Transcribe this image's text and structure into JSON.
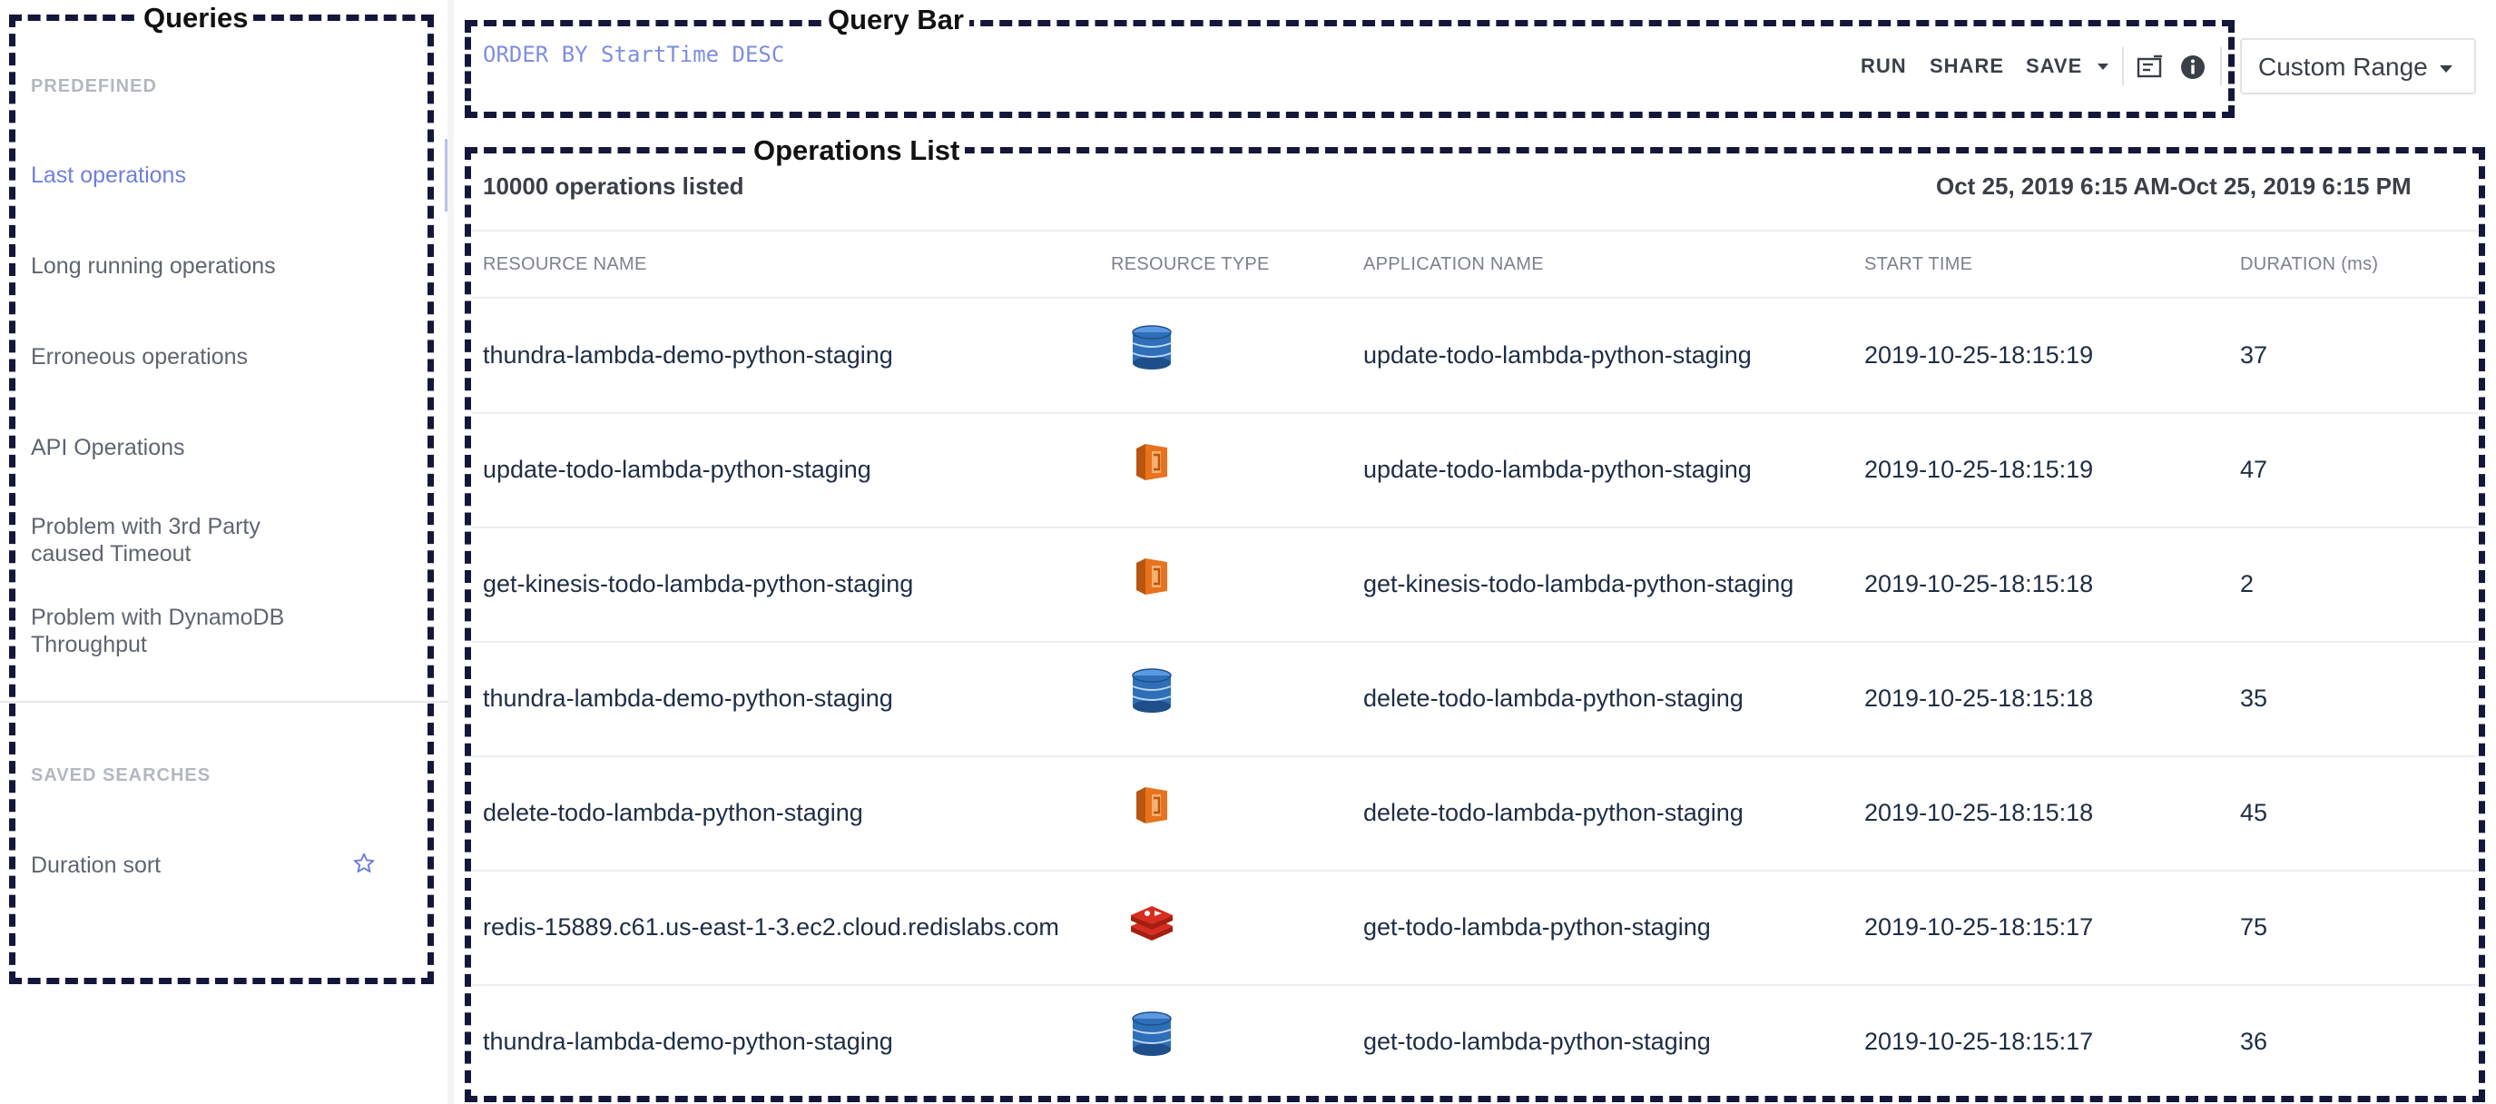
{
  "sidebar": {
    "title": "Queries",
    "predefined_header": "PREDEFINED",
    "predefined": [
      {
        "label": "Last operations",
        "active": true
      },
      {
        "label": "Long running operations",
        "active": false
      },
      {
        "label": "Erroneous operations",
        "active": false
      },
      {
        "label": "API Operations",
        "active": false
      },
      {
        "label": "Problem with 3rd Party caused Timeout",
        "active": false
      },
      {
        "label": "Problem with DynamoDB Throughput",
        "active": false
      }
    ],
    "saved_header": "SAVED SEARCHES",
    "saved": [
      {
        "label": "Duration sort",
        "icon": "star-icon"
      }
    ]
  },
  "query_bar": {
    "title": "Query Bar",
    "query": "ORDER BY StartTime DESC",
    "run": "RUN",
    "share": "SHARE",
    "save": "SAVE",
    "icons": [
      "notes-icon",
      "info-icon"
    ],
    "range": "Custom Range"
  },
  "operations": {
    "title": "Operations List",
    "count_text": "10000 operations listed",
    "range_text": "Oct 25, 2019 6:15 AM-Oct 25, 2019 6:15 PM",
    "columns": [
      "RESOURCE NAME",
      "RESOURCE TYPE",
      "APPLICATION NAME",
      "START TIME",
      "DURATION (ms)"
    ],
    "rows": [
      {
        "resource": "thundra-lambda-demo-python-staging",
        "type_icon": "dynamodb-icon",
        "app": "update-todo-lambda-python-staging",
        "start": "2019-10-25-18:15:19",
        "duration": "37"
      },
      {
        "resource": "update-todo-lambda-python-staging",
        "type_icon": "lambda-icon",
        "app": "update-todo-lambda-python-staging",
        "start": "2019-10-25-18:15:19",
        "duration": "47"
      },
      {
        "resource": "get-kinesis-todo-lambda-python-staging",
        "type_icon": "lambda-icon",
        "app": "get-kinesis-todo-lambda-python-staging",
        "start": "2019-10-25-18:15:18",
        "duration": "2"
      },
      {
        "resource": "thundra-lambda-demo-python-staging",
        "type_icon": "dynamodb-icon",
        "app": "delete-todo-lambda-python-staging",
        "start": "2019-10-25-18:15:18",
        "duration": "35"
      },
      {
        "resource": "delete-todo-lambda-python-staging",
        "type_icon": "lambda-icon",
        "app": "delete-todo-lambda-python-staging",
        "start": "2019-10-25-18:15:18",
        "duration": "45"
      },
      {
        "resource": "redis-15889.c61.us-east-1-3.ec2.cloud.redislabs.com",
        "type_icon": "redis-icon",
        "app": "get-todo-lambda-python-staging",
        "start": "2019-10-25-18:15:17",
        "duration": "75"
      },
      {
        "resource": "thundra-lambda-demo-python-staging",
        "type_icon": "dynamodb-icon",
        "app": "get-todo-lambda-python-staging",
        "start": "2019-10-25-18:15:17",
        "duration": "36"
      }
    ]
  },
  "colors": {
    "accent": "#6f80d9",
    "annotation_border": "#14163a",
    "lambda": "#e8731f",
    "dynamodb": "#2e6fb7",
    "redis": "#d82c20"
  }
}
